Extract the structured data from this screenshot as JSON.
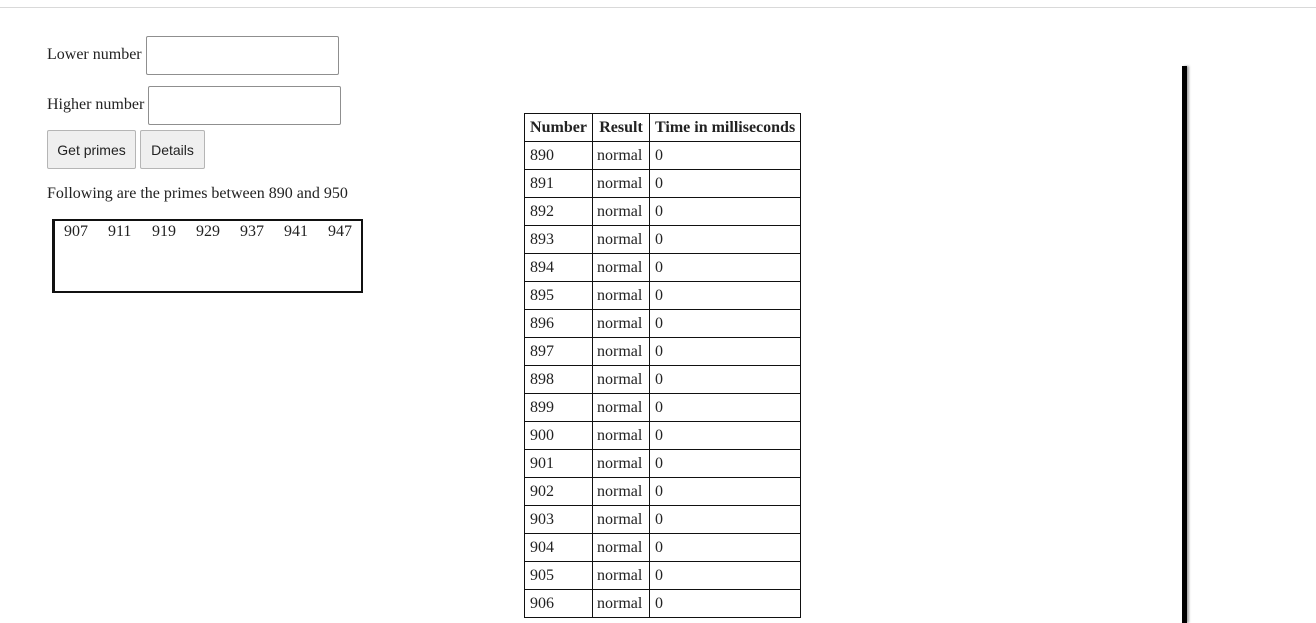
{
  "form": {
    "lower_label": "Lower number",
    "lower_value": "",
    "higher_label": "Higher number",
    "higher_value": "",
    "get_primes_label": "Get primes",
    "details_label": "Details"
  },
  "result": {
    "message": "Following are the primes between 890 and 950",
    "primes": [
      "907",
      "911",
      "919",
      "929",
      "937",
      "941",
      "947"
    ]
  },
  "table": {
    "headers": [
      "Number",
      "Result",
      "Time in milliseconds"
    ],
    "rows": [
      {
        "number": "890",
        "result": "normal",
        "time": "0"
      },
      {
        "number": "891",
        "result": "normal",
        "time": "0"
      },
      {
        "number": "892",
        "result": "normal",
        "time": "0"
      },
      {
        "number": "893",
        "result": "normal",
        "time": "0"
      },
      {
        "number": "894",
        "result": "normal",
        "time": "0"
      },
      {
        "number": "895",
        "result": "normal",
        "time": "0"
      },
      {
        "number": "896",
        "result": "normal",
        "time": "0"
      },
      {
        "number": "897",
        "result": "normal",
        "time": "0"
      },
      {
        "number": "898",
        "result": "normal",
        "time": "0"
      },
      {
        "number": "899",
        "result": "normal",
        "time": "0"
      },
      {
        "number": "900",
        "result": "normal",
        "time": "0"
      },
      {
        "number": "901",
        "result": "normal",
        "time": "0"
      },
      {
        "number": "902",
        "result": "normal",
        "time": "0"
      },
      {
        "number": "903",
        "result": "normal",
        "time": "0"
      },
      {
        "number": "904",
        "result": "normal",
        "time": "0"
      },
      {
        "number": "905",
        "result": "normal",
        "time": "0"
      },
      {
        "number": "906",
        "result": "normal",
        "time": "0"
      }
    ]
  }
}
